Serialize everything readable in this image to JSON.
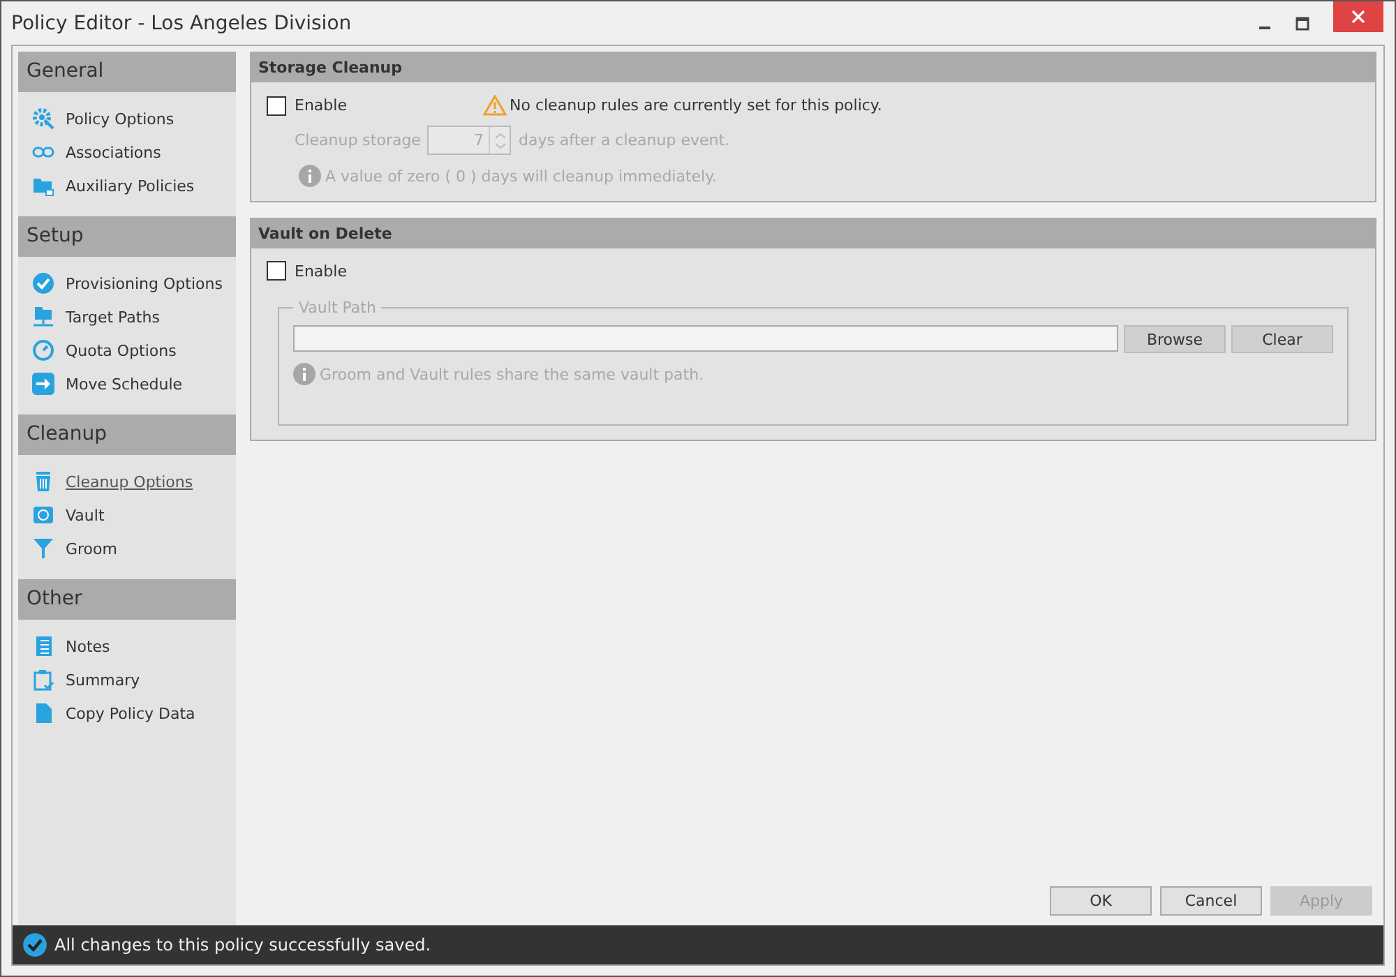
{
  "window": {
    "title": "Policy Editor - Los Angeles Division"
  },
  "sidebar": {
    "groups": [
      {
        "title": "General",
        "items": [
          {
            "label": "Policy Options",
            "selected": false
          },
          {
            "label": "Associations",
            "selected": false
          },
          {
            "label": "Auxiliary Policies",
            "selected": false
          }
        ]
      },
      {
        "title": "Setup",
        "items": [
          {
            "label": "Provisioning Options",
            "selected": false
          },
          {
            "label": "Target Paths",
            "selected": false
          },
          {
            "label": "Quota Options",
            "selected": false
          },
          {
            "label": "Move Schedule",
            "selected": false
          }
        ]
      },
      {
        "title": "Cleanup",
        "items": [
          {
            "label": "Cleanup Options",
            "selected": true
          },
          {
            "label": "Vault",
            "selected": false
          },
          {
            "label": "Groom",
            "selected": false
          }
        ]
      },
      {
        "title": "Other",
        "items": [
          {
            "label": "Notes",
            "selected": false
          },
          {
            "label": "Summary",
            "selected": false
          },
          {
            "label": "Copy Policy Data",
            "selected": false
          }
        ]
      }
    ]
  },
  "storage_cleanup": {
    "title": "Storage Cleanup",
    "enable": {
      "label": "Enable",
      "checked": false
    },
    "warning": "No cleanup rules are currently set for this policy.",
    "storage_label": "Cleanup storage",
    "days": {
      "value": "7",
      "disabled": true
    },
    "days_suffix": "days after a cleanup event.",
    "info": "A value of zero ( 0 ) days will cleanup immediately."
  },
  "vault_on_delete": {
    "title": "Vault on Delete",
    "enable": {
      "label": "Enable",
      "checked": false
    },
    "group_title": "Vault Path",
    "path": {
      "disabled": true
    },
    "buttons": [
      {
        "label": "Browse"
      },
      {
        "label": "Clear"
      }
    ],
    "info": "Groom and Vault rules share the same vault path."
  },
  "buttons": [
    {
      "label": "OK",
      "disabled": false
    },
    {
      "label": "Cancel",
      "disabled": false
    },
    {
      "label": "Apply",
      "disabled": true
    }
  ],
  "status_bar": {
    "message": "All changes to this policy successfully saved."
  }
}
